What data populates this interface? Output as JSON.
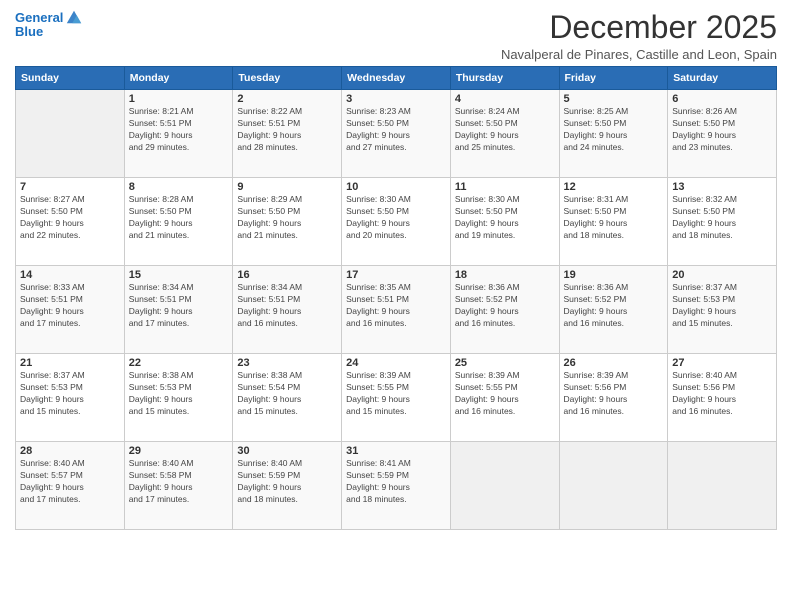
{
  "header": {
    "logo_line1": "General",
    "logo_line2": "Blue",
    "title": "December 2025",
    "subtitle": "Navalperal de Pinares, Castille and Leon, Spain"
  },
  "weekdays": [
    "Sunday",
    "Monday",
    "Tuesday",
    "Wednesday",
    "Thursday",
    "Friday",
    "Saturday"
  ],
  "weeks": [
    [
      {
        "day": "",
        "info": ""
      },
      {
        "day": "1",
        "info": "Sunrise: 8:21 AM\nSunset: 5:51 PM\nDaylight: 9 hours\nand 29 minutes."
      },
      {
        "day": "2",
        "info": "Sunrise: 8:22 AM\nSunset: 5:51 PM\nDaylight: 9 hours\nand 28 minutes."
      },
      {
        "day": "3",
        "info": "Sunrise: 8:23 AM\nSunset: 5:50 PM\nDaylight: 9 hours\nand 27 minutes."
      },
      {
        "day": "4",
        "info": "Sunrise: 8:24 AM\nSunset: 5:50 PM\nDaylight: 9 hours\nand 25 minutes."
      },
      {
        "day": "5",
        "info": "Sunrise: 8:25 AM\nSunset: 5:50 PM\nDaylight: 9 hours\nand 24 minutes."
      },
      {
        "day": "6",
        "info": "Sunrise: 8:26 AM\nSunset: 5:50 PM\nDaylight: 9 hours\nand 23 minutes."
      }
    ],
    [
      {
        "day": "7",
        "info": "Sunrise: 8:27 AM\nSunset: 5:50 PM\nDaylight: 9 hours\nand 22 minutes."
      },
      {
        "day": "8",
        "info": "Sunrise: 8:28 AM\nSunset: 5:50 PM\nDaylight: 9 hours\nand 21 minutes."
      },
      {
        "day": "9",
        "info": "Sunrise: 8:29 AM\nSunset: 5:50 PM\nDaylight: 9 hours\nand 21 minutes."
      },
      {
        "day": "10",
        "info": "Sunrise: 8:30 AM\nSunset: 5:50 PM\nDaylight: 9 hours\nand 20 minutes."
      },
      {
        "day": "11",
        "info": "Sunrise: 8:30 AM\nSunset: 5:50 PM\nDaylight: 9 hours\nand 19 minutes."
      },
      {
        "day": "12",
        "info": "Sunrise: 8:31 AM\nSunset: 5:50 PM\nDaylight: 9 hours\nand 18 minutes."
      },
      {
        "day": "13",
        "info": "Sunrise: 8:32 AM\nSunset: 5:50 PM\nDaylight: 9 hours\nand 18 minutes."
      }
    ],
    [
      {
        "day": "14",
        "info": "Sunrise: 8:33 AM\nSunset: 5:51 PM\nDaylight: 9 hours\nand 17 minutes."
      },
      {
        "day": "15",
        "info": "Sunrise: 8:34 AM\nSunset: 5:51 PM\nDaylight: 9 hours\nand 17 minutes."
      },
      {
        "day": "16",
        "info": "Sunrise: 8:34 AM\nSunset: 5:51 PM\nDaylight: 9 hours\nand 16 minutes."
      },
      {
        "day": "17",
        "info": "Sunrise: 8:35 AM\nSunset: 5:51 PM\nDaylight: 9 hours\nand 16 minutes."
      },
      {
        "day": "18",
        "info": "Sunrise: 8:36 AM\nSunset: 5:52 PM\nDaylight: 9 hours\nand 16 minutes."
      },
      {
        "day": "19",
        "info": "Sunrise: 8:36 AM\nSunset: 5:52 PM\nDaylight: 9 hours\nand 16 minutes."
      },
      {
        "day": "20",
        "info": "Sunrise: 8:37 AM\nSunset: 5:53 PM\nDaylight: 9 hours\nand 15 minutes."
      }
    ],
    [
      {
        "day": "21",
        "info": "Sunrise: 8:37 AM\nSunset: 5:53 PM\nDaylight: 9 hours\nand 15 minutes."
      },
      {
        "day": "22",
        "info": "Sunrise: 8:38 AM\nSunset: 5:53 PM\nDaylight: 9 hours\nand 15 minutes."
      },
      {
        "day": "23",
        "info": "Sunrise: 8:38 AM\nSunset: 5:54 PM\nDaylight: 9 hours\nand 15 minutes."
      },
      {
        "day": "24",
        "info": "Sunrise: 8:39 AM\nSunset: 5:55 PM\nDaylight: 9 hours\nand 15 minutes."
      },
      {
        "day": "25",
        "info": "Sunrise: 8:39 AM\nSunset: 5:55 PM\nDaylight: 9 hours\nand 16 minutes."
      },
      {
        "day": "26",
        "info": "Sunrise: 8:39 AM\nSunset: 5:56 PM\nDaylight: 9 hours\nand 16 minutes."
      },
      {
        "day": "27",
        "info": "Sunrise: 8:40 AM\nSunset: 5:56 PM\nDaylight: 9 hours\nand 16 minutes."
      }
    ],
    [
      {
        "day": "28",
        "info": "Sunrise: 8:40 AM\nSunset: 5:57 PM\nDaylight: 9 hours\nand 17 minutes."
      },
      {
        "day": "29",
        "info": "Sunrise: 8:40 AM\nSunset: 5:58 PM\nDaylight: 9 hours\nand 17 minutes."
      },
      {
        "day": "30",
        "info": "Sunrise: 8:40 AM\nSunset: 5:59 PM\nDaylight: 9 hours\nand 18 minutes."
      },
      {
        "day": "31",
        "info": "Sunrise: 8:41 AM\nSunset: 5:59 PM\nDaylight: 9 hours\nand 18 minutes."
      },
      {
        "day": "",
        "info": ""
      },
      {
        "day": "",
        "info": ""
      },
      {
        "day": "",
        "info": ""
      }
    ]
  ]
}
